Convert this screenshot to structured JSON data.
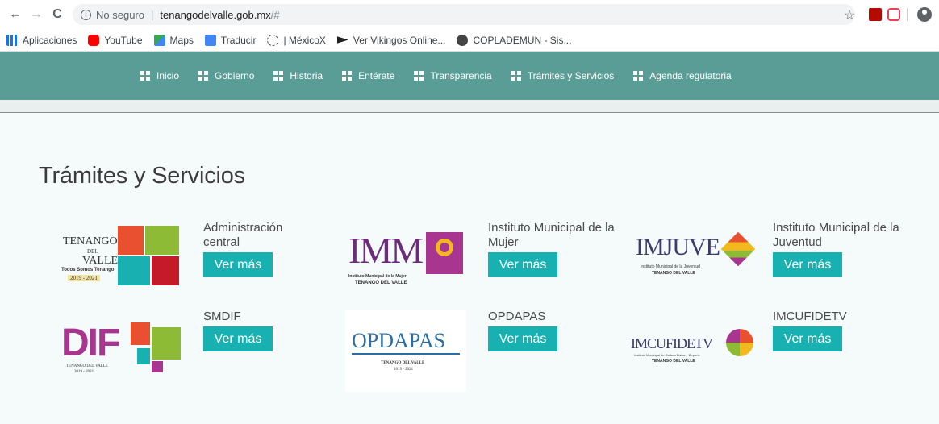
{
  "browser": {
    "back": "←",
    "forward": "→",
    "reload": "C",
    "security": "No seguro",
    "host": "tenangodelvalle.gob.mx",
    "path": "/#",
    "bookmarks": [
      {
        "label": "Aplicaciones"
      },
      {
        "label": "YouTube"
      },
      {
        "label": "Maps"
      },
      {
        "label": "Traducir"
      },
      {
        "label": "| MéxicoX"
      },
      {
        "label": "Ver Vikingos Online..."
      },
      {
        "label": "COPLADEMUN - Sis..."
      }
    ]
  },
  "nav": {
    "items": [
      {
        "label": "Inicio"
      },
      {
        "label": "Gobierno"
      },
      {
        "label": "Historia"
      },
      {
        "label": "Entérate"
      },
      {
        "label": "Transparencia"
      },
      {
        "label": "Trámites y Servicios"
      },
      {
        "label": "Agenda regulatoria"
      }
    ]
  },
  "section": {
    "title": "Trámites y Servicios",
    "button_label": "Ver más",
    "cards": [
      {
        "title": "Administración central",
        "logo_name": "TENANGO",
        "logo_sub": "DEL",
        "logo_sub2": "VALLE",
        "logo_tag": "Todos Somos Tenango",
        "logo_years": "2019 - 2021"
      },
      {
        "title": "Instituto Municipal de la Mujer",
        "logo_name": "IMM",
        "logo_sub": "Instituto Municipal de la Mujer",
        "logo_sub2": "TENANGO DEL VALLE"
      },
      {
        "title": "Instituto Municipal de la Juventud",
        "logo_name": "IMJUVE",
        "logo_sub": "Instituto Municipal de la Juventud",
        "logo_sub2": "TENANGO DEL VALLE"
      },
      {
        "title": "SMDIF",
        "logo_name": "DIF",
        "logo_sub": "TENANGO DEL VALLE",
        "logo_sub2": "2019 - 2021"
      },
      {
        "title": "OPDAPAS",
        "logo_name": "OPDAPAS",
        "logo_sub": "TENANGO DEL VALLE",
        "logo_sub2": "2019 - 2021"
      },
      {
        "title": "IMCUFIDETV",
        "logo_name": "IMCUFIDETV",
        "logo_sub": "Instituto Municipal de Cultura Física y Deporte",
        "logo_sub2": "TENANGO DEL VALLE"
      }
    ]
  },
  "colors": {
    "nav_bg": "#5a9d96",
    "button_bg": "#18b0b0",
    "page_bg": "#f5fafa"
  }
}
